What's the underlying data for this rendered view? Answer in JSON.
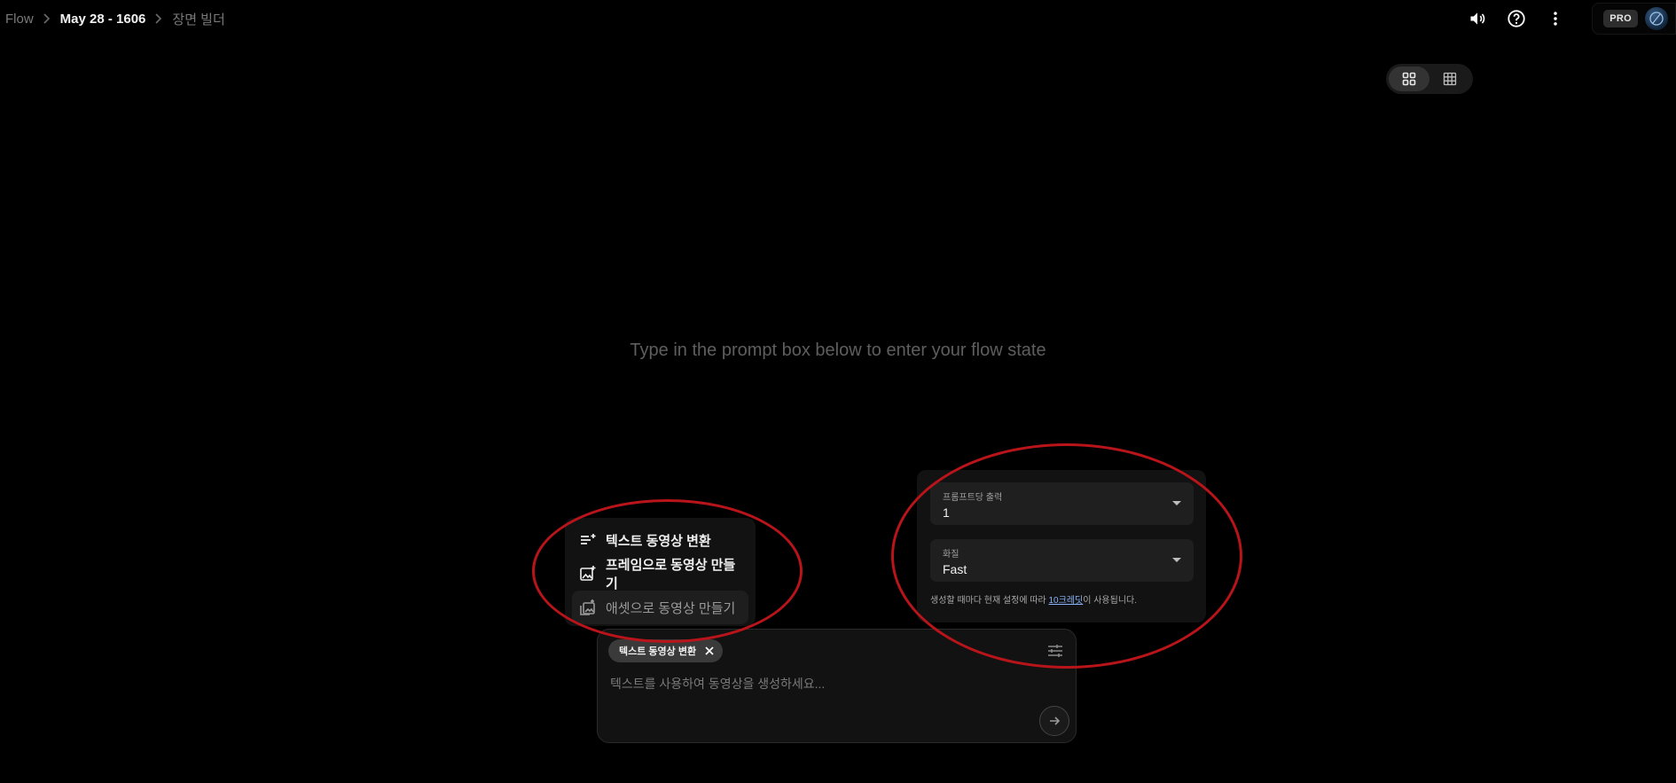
{
  "breadcrumb": {
    "root": "Flow",
    "project": "May 28 - 1606",
    "page": "장면 빌더"
  },
  "header": {
    "icons": [
      "volume-icon",
      "help-icon",
      "more-vert-icon"
    ],
    "badge": "PRO"
  },
  "view_toggle": {
    "options": [
      "grid-large-icon",
      "grid-small-icon"
    ],
    "active": 0
  },
  "empty_state": {
    "message": "Type in the prompt box below to enter your flow state"
  },
  "mode_menu": {
    "items": [
      {
        "label": "텍스트 동영상 변환",
        "icon": "text-to-video-icon"
      },
      {
        "label": "프레임으로 동영상 만들기",
        "icon": "frames-to-video-icon"
      },
      {
        "label": "애셋으로 동영상 만들기",
        "icon": "assets-to-video-icon"
      }
    ]
  },
  "settings": {
    "outputs_label": "프롬프트당 출력",
    "outputs_value": "1",
    "quality_label": "화질",
    "quality_value": "Fast",
    "note_before": "생성할 때마다 현재 설정에 따라 ",
    "note_link": "10크레딧",
    "note_after": "이 사용됩니다."
  },
  "prompt": {
    "chip_label": "텍스트 동영상 변환",
    "placeholder": "텍스트를 사용하여 동영상을 생성하세요..."
  },
  "colors": {
    "background": "#000000",
    "annotation": "#b8141a",
    "link": "#8ab4f8"
  }
}
